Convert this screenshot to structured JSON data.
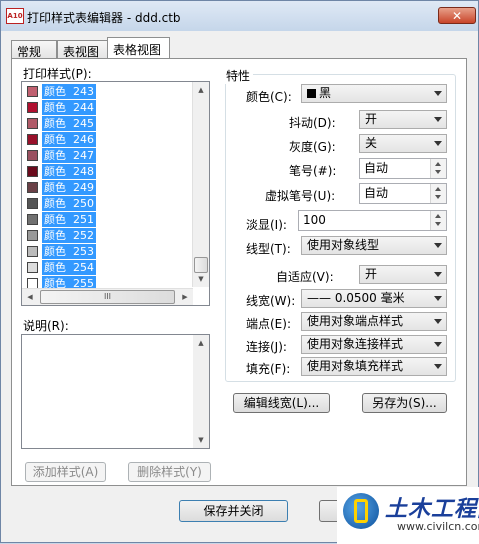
{
  "window": {
    "app_icon_text": "A10",
    "title": "打印样式表编辑器 - ddd.ctb",
    "close": "✕"
  },
  "tabs": [
    "常规",
    "表视图",
    "表格视图"
  ],
  "left": {
    "styles_label": "打印样式(P):",
    "styles": [
      {
        "label": "颜色  243",
        "color": "#c06070"
      },
      {
        "label": "颜色  244",
        "color": "#b01030"
      },
      {
        "label": "颜色  245",
        "color": "#b05a68"
      },
      {
        "label": "颜色  246",
        "color": "#98102a"
      },
      {
        "label": "颜色  247",
        "color": "#9a5060"
      },
      {
        "label": "颜色  248",
        "color": "#6a0a1c"
      },
      {
        "label": "颜色  249",
        "color": "#6a4046"
      },
      {
        "label": "颜色  250",
        "color": "#555555"
      },
      {
        "label": "颜色  251",
        "color": "#707070"
      },
      {
        "label": "颜色  252",
        "color": "#999999"
      },
      {
        "label": "颜色  253",
        "color": "#bbbbbb"
      },
      {
        "label": "颜色  254",
        "color": "#dcdcdc"
      },
      {
        "label": "颜色  255",
        "color": "#ffffff"
      }
    ],
    "scroll_thumb_label": "III",
    "desc_label": "说明(R):",
    "add_style": "添加样式(A)",
    "delete_style": "删除样式(Y)"
  },
  "props": {
    "group_title": "特性",
    "color_label": "颜色(C):",
    "color_value": "黑",
    "dither_label": "抖动(D):",
    "dither_value": "开",
    "grayscale_label": "灰度(G):",
    "grayscale_value": "关",
    "pen_label": "笔号(#):",
    "pen_value": "自动",
    "vpen_label": "虚拟笔号(U):",
    "vpen_value": "自动",
    "screening_label": "淡显(I):",
    "screening_value": "100",
    "linetype_label": "线型(T):",
    "linetype_value": "使用对象线型",
    "adaptive_label": "自适应(V):",
    "adaptive_value": "开",
    "lineweight_label": "线宽(W):",
    "lineweight_value": "—— 0.0500 毫米",
    "endcap_label": "端点(E):",
    "endcap_value": "使用对象端点样式",
    "join_label": "连接(J):",
    "join_value": "使用对象连接样式",
    "fill_label": "填充(F):",
    "fill_value": "使用对象填充样式",
    "edit_lineweights": "编辑线宽(L)...",
    "save_as": "另存为(S)..."
  },
  "footer": {
    "save_close": "保存并关闭",
    "partial_btn": "I"
  },
  "watermark": {
    "title": "土木工程网",
    "url": "www.civilcn.com"
  }
}
